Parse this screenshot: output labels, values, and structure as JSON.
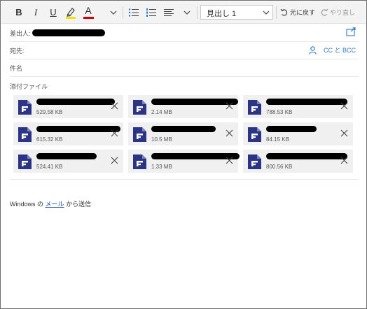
{
  "toolbar": {
    "bold_label": "B",
    "italic_label": "I",
    "underline_label": "U",
    "font_color_label": "A",
    "heading_style_value": "見出し 1",
    "undo_label": "元に戻す",
    "redo_label": "やり直し",
    "highlight_color": "#f2e200",
    "font_color": "#d40000",
    "icons": [
      "highlighter-icon",
      "chevron-down-icon",
      "bullet-list-icon",
      "numbered-list-icon",
      "align-icon",
      "undo-icon",
      "redo-icon"
    ]
  },
  "compose": {
    "from_label": "差出人:",
    "to_label": "宛先:",
    "subject_label": "件名",
    "cc_bcc_label": "CC と BCC",
    "popout_icon": "popout-icon",
    "person_icon": "person-icon"
  },
  "attachments": {
    "label": "添付ファイル",
    "files": [
      {
        "size": "529.58 KB"
      },
      {
        "size": "2.14 MB"
      },
      {
        "size": "788.53 KB"
      },
      {
        "size": "615.32 KB"
      },
      {
        "size": "10.5 MB"
      },
      {
        "size": "84.15 KB"
      },
      {
        "size": "524.41 KB"
      },
      {
        "size": "1.33 MB"
      },
      {
        "size": "800.56 KB"
      }
    ]
  },
  "signature": {
    "prefix": "Windows の",
    "link_text": "メール",
    "suffix": "から送信"
  },
  "colors": {
    "accent": "#2b79c7",
    "file_icon": "#2c3486",
    "tile_bg": "#f0f0f0"
  }
}
